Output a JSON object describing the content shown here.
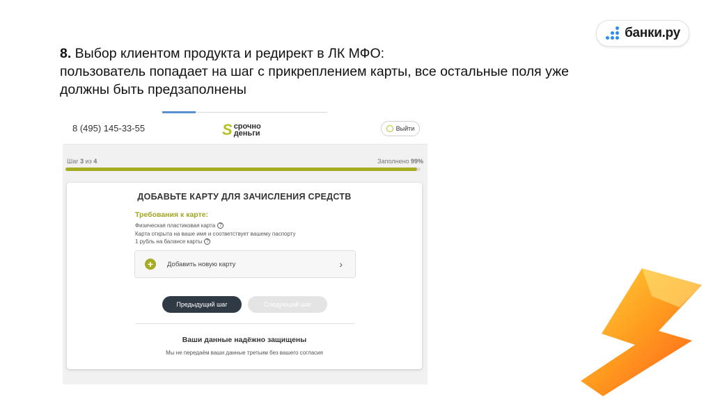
{
  "logo": {
    "text": "банки.ру",
    "icon": "dots-logo-icon",
    "color": "#2a8cf0"
  },
  "slide": {
    "number": "8.",
    "heading": " Выбор клиентом продукта и редирект в ЛК МФО:",
    "line2": "пользователь попадает на шаг с прикреплением карты, все остальные поля уже",
    "line3": "должны быть предзаполнены"
  },
  "screenshot": {
    "header": {
      "phone": "8 (495) 145-33-55",
      "brand_line1": "срочно",
      "brand_line2": "деньги",
      "exit_label": "Выйти",
      "brand_color": "#b7c11d"
    },
    "step": {
      "prefix": "Шаг",
      "current": "3",
      "of": "из",
      "total": "4"
    },
    "filled": {
      "label": "Заполнено",
      "value": "99%",
      "fraction": 0.99
    },
    "card": {
      "title": "ДОБАВЬТЕ КАРТУ ДЛЯ ЗАЧИСЛЕНИЯ СРЕДСТВ",
      "requirements_title": "Требования к карте:",
      "requirements": [
        "Физическая пластиковая карта",
        "Карта открыта на ваше имя и соответствует вашему паспорту",
        "1 рубль на балансе карты"
      ],
      "add_card_label": "Добавить новую карту",
      "prev_button": "Предыдущий шаг",
      "next_button": "Следующий шаг",
      "secure_title": "Ваши данные надёжно защищены",
      "secure_subtitle": "Мы не передаём ваши данные третьим без вашего согласия"
    }
  }
}
